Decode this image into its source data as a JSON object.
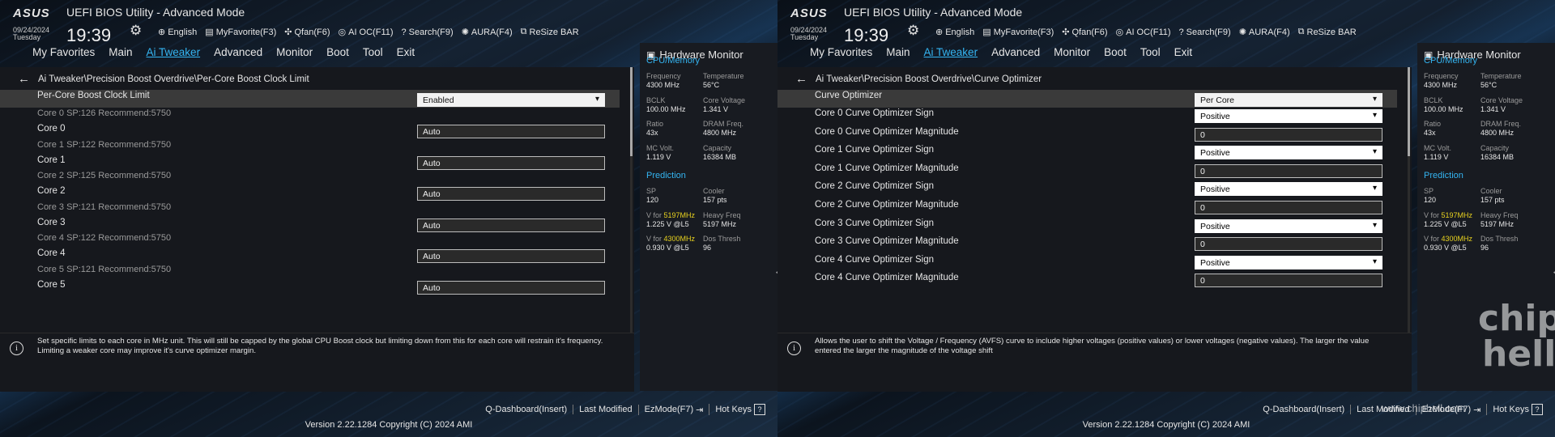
{
  "screens": [
    {
      "header": {
        "logo": "ASUS",
        "title": "UEFI BIOS Utility - Advanced Mode",
        "date": "09/24/2024",
        "day": "Tuesday",
        "time": "19:39",
        "toolbar": [
          {
            "icon": "globe-icon",
            "label": "English"
          },
          {
            "icon": "favorite-icon",
            "label": "MyFavorite(F3)"
          },
          {
            "icon": "fan-icon",
            "label": "Qfan(F6)"
          },
          {
            "icon": "ai-oc-icon",
            "label": "AI OC(F11)"
          },
          {
            "icon": "search-icon",
            "label": "Search(F9)"
          },
          {
            "icon": "aura-icon",
            "label": "AURA(F4)"
          },
          {
            "icon": "resize-bar-icon",
            "label": "ReSize BAR"
          }
        ]
      },
      "menu": [
        "My Favorites",
        "Main",
        "Ai Tweaker",
        "Advanced",
        "Monitor",
        "Boot",
        "Tool",
        "Exit"
      ],
      "menu_active": "Ai Tweaker",
      "breadcrumb": "Ai Tweaker\\Precision Boost Overdrive\\Per-Core Boost Clock Limit",
      "rows": [
        {
          "kind": "option",
          "label": "Per-Core Boost Clock Limit",
          "value": "Enabled",
          "control": "dropdown",
          "selected": true
        },
        {
          "kind": "info",
          "label": "Core 0  SP:126  Recommend:5750"
        },
        {
          "kind": "option",
          "label": "Core 0",
          "value": "Auto",
          "control": "field"
        },
        {
          "kind": "info",
          "label": "Core 1  SP:122  Recommend:5750"
        },
        {
          "kind": "option",
          "label": "Core 1",
          "value": "Auto",
          "control": "field"
        },
        {
          "kind": "info",
          "label": "Core 2  SP:125  Recommend:5750"
        },
        {
          "kind": "option",
          "label": "Core 2",
          "value": "Auto",
          "control": "field"
        },
        {
          "kind": "info",
          "label": "Core 3  SP:121  Recommend:5750"
        },
        {
          "kind": "option",
          "label": "Core 3",
          "value": "Auto",
          "control": "field"
        },
        {
          "kind": "info",
          "label": "Core 4  SP:122  Recommend:5750"
        },
        {
          "kind": "option",
          "label": "Core 4",
          "value": "Auto",
          "control": "field"
        },
        {
          "kind": "info",
          "label": "Core 5  SP:121  Recommend:5750"
        },
        {
          "kind": "option",
          "label": "Core 5",
          "value": "Auto",
          "control": "field"
        }
      ],
      "help": "Set specific limits to each core in MHz unit. This will still be capped by the global CPU Boost clock but limiting down from this for each core will restrain it's frequency. Limiting a weaker core may improve it's curve optimizer margin."
    },
    {
      "header": {
        "logo": "ASUS",
        "title": "UEFI BIOS Utility - Advanced Mode",
        "date": "09/24/2024",
        "day": "Tuesday",
        "time": "19:39",
        "toolbar": [
          {
            "icon": "globe-icon",
            "label": "English"
          },
          {
            "icon": "favorite-icon",
            "label": "MyFavorite(F3)"
          },
          {
            "icon": "fan-icon",
            "label": "Qfan(F6)"
          },
          {
            "icon": "ai-oc-icon",
            "label": "AI OC(F11)"
          },
          {
            "icon": "search-icon",
            "label": "Search(F9)"
          },
          {
            "icon": "aura-icon",
            "label": "AURA(F4)"
          },
          {
            "icon": "resize-bar-icon",
            "label": "ReSize BAR"
          }
        ]
      },
      "menu": [
        "My Favorites",
        "Main",
        "Ai Tweaker",
        "Advanced",
        "Monitor",
        "Boot",
        "Tool",
        "Exit"
      ],
      "menu_active": "Ai Tweaker",
      "breadcrumb": "Ai Tweaker\\Precision Boost Overdrive\\Curve Optimizer",
      "rows": [
        {
          "kind": "option",
          "label": "Curve Optimizer",
          "value": "Per Core",
          "control": "dropdown",
          "selected": true
        },
        {
          "kind": "option",
          "label": "Core 0 Curve Optimizer Sign",
          "value": "Positive",
          "control": "select"
        },
        {
          "kind": "option",
          "label": "Core 0 Curve Optimizer Magnitude",
          "value": "0",
          "control": "field"
        },
        {
          "kind": "option",
          "label": "Core 1 Curve Optimizer Sign",
          "value": "Positive",
          "control": "select"
        },
        {
          "kind": "option",
          "label": "Core 1 Curve Optimizer Magnitude",
          "value": "0",
          "control": "field"
        },
        {
          "kind": "option",
          "label": "Core 2 Curve Optimizer Sign",
          "value": "Positive",
          "control": "select"
        },
        {
          "kind": "option",
          "label": "Core 2 Curve Optimizer Magnitude",
          "value": "0",
          "control": "field"
        },
        {
          "kind": "option",
          "label": "Core 3 Curve Optimizer Sign",
          "value": "Positive",
          "control": "select"
        },
        {
          "kind": "option",
          "label": "Core 3 Curve Optimizer Magnitude",
          "value": "0",
          "control": "field"
        },
        {
          "kind": "option",
          "label": "Core 4 Curve Optimizer Sign",
          "value": "Positive",
          "control": "select"
        },
        {
          "kind": "option",
          "label": "Core 4 Curve Optimizer Magnitude",
          "value": "0",
          "control": "field"
        }
      ],
      "help": "Allows the user to shift the Voltage / Frequency (AVFS) curve to include higher voltages (positive values) or lower voltages (negative values). The larger the value entered the larger the magnitude of the voltage shift"
    }
  ],
  "hardware_monitor": {
    "title": "Hardware Monitor",
    "cpu_memory": {
      "heading": "CPU/Memory",
      "items": [
        {
          "label": "Frequency",
          "value": "4300 MHz"
        },
        {
          "label": "Temperature",
          "value": "56°C"
        },
        {
          "label": "BCLK",
          "value": "100.00 MHz"
        },
        {
          "label": "Core Voltage",
          "value": "1.341 V"
        },
        {
          "label": "Ratio",
          "value": "43x"
        },
        {
          "label": "DRAM Freq.",
          "value": "4800 MHz"
        },
        {
          "label": "MC Volt.",
          "value": "1.119 V"
        },
        {
          "label": "Capacity",
          "value": "16384 MB"
        }
      ]
    },
    "prediction": {
      "heading": "Prediction",
      "items": [
        {
          "label": "SP",
          "value": "120"
        },
        {
          "label": "Cooler",
          "value": "157 pts"
        },
        {
          "label": "V for",
          "label_hl": "5197MHz",
          "value": "1.225 V @L5"
        },
        {
          "label": "Heavy Freq",
          "value": "5197 MHz"
        },
        {
          "label": "V for",
          "label_hl": "4300MHz",
          "value": "0.930 V @L5"
        },
        {
          "label": "Dos Thresh",
          "value": "96"
        }
      ]
    }
  },
  "footer": {
    "links": [
      "Q-Dashboard(Insert)",
      "Last Modified",
      "EzMode(F7)",
      "Hot Keys"
    ],
    "hotkeys_icon": "?",
    "version": "Version 2.22.1284 Copyright (C) 2024 AMI"
  },
  "watermark": {
    "logo_top": "chip",
    "logo_bottom": "hell",
    "url": "www.chiphell.com"
  },
  "colors": {
    "accent": "#34b5f2",
    "highlight": "#e8d21f",
    "panel": "#16181d",
    "selected_row": "#3a3a3a"
  }
}
